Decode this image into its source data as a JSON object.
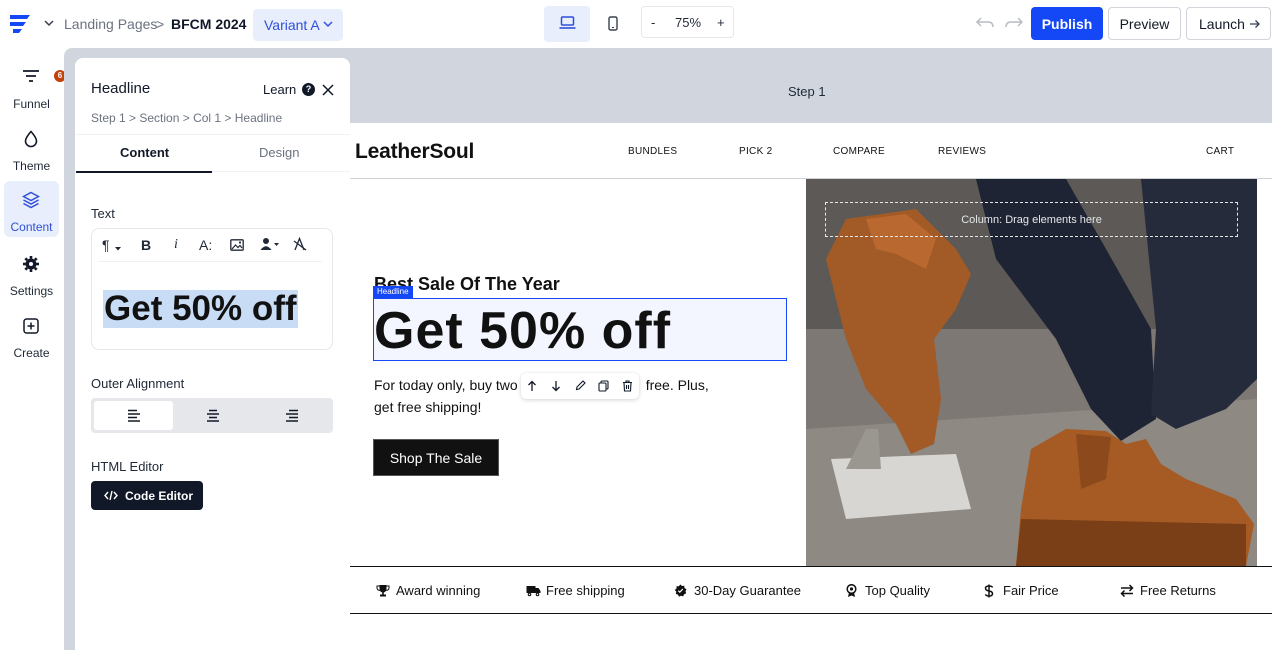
{
  "topbar": {
    "breadcrumb_root": "Landing Pages",
    "breadcrumb_sep": ">",
    "breadcrumb_current": "BFCM 2024",
    "variant": "Variant A",
    "zoom_minus": "-",
    "zoom_value": "75%",
    "zoom_plus": "+",
    "publish": "Publish",
    "preview": "Preview",
    "launch": "Launch",
    "accent": "#1447f5"
  },
  "rail": {
    "items": [
      {
        "label": "Funnel",
        "icon": "filter-icon",
        "badge": "6"
      },
      {
        "label": "Theme",
        "icon": "droplet-icon"
      },
      {
        "label": "Content",
        "icon": "layers-icon"
      },
      {
        "label": "Settings",
        "icon": "gear-icon"
      },
      {
        "label": "Create",
        "icon": "plus-square-icon"
      }
    ]
  },
  "canvas": {
    "step_label": "Step 1"
  },
  "panel": {
    "title": "Headline",
    "learn": "Learn",
    "help": "?",
    "path": "Step 1 > Section > Col 1 > Headline",
    "tabs": [
      "Content",
      "Design"
    ],
    "text_label": "Text",
    "text_value": "Get 50% off",
    "outer_alignment_label": "Outer Alignment",
    "html_editor_label": "HTML Editor",
    "code_editor": "Code Editor"
  },
  "page": {
    "brand": "LeatherSoul",
    "nav": [
      "BUNDLES",
      "PICK 2",
      "COMPARE",
      "REVIEWS",
      "CART"
    ],
    "kicker": "Best Sale Of The Year",
    "headline_tag": "Headline",
    "headline": "Get 50% off",
    "body_line1": "For today only, buy two",
    "body_line1_end": "free. Plus,",
    "body_line2": "get free shipping!",
    "cta": "Shop The Sale",
    "column_drop": "Column: Drag elements here",
    "trust": [
      "Award winning",
      "Free shipping",
      "30-Day Guarantee",
      "Top Quality",
      "Fair Price",
      "Free Returns"
    ]
  }
}
